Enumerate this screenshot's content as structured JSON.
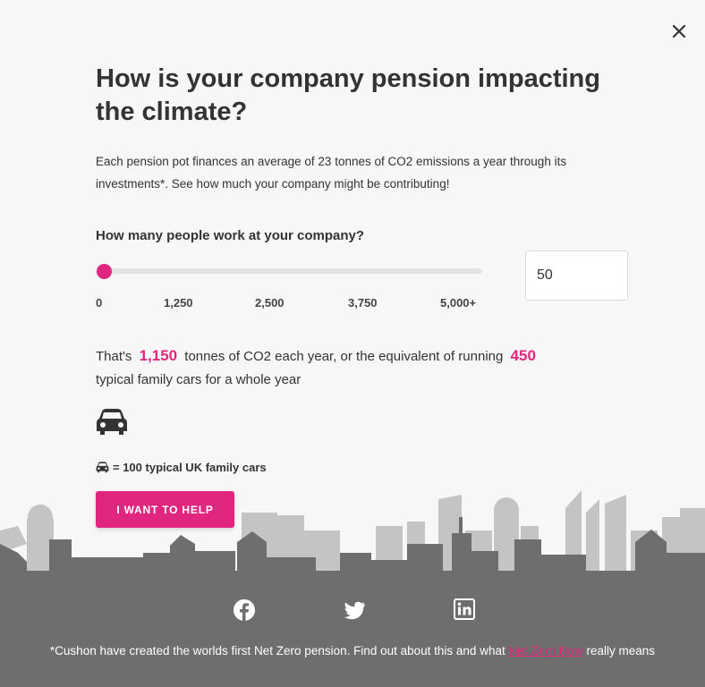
{
  "modal": {
    "close_icon": "close-icon",
    "title": "How is your company pension impacting the climate?",
    "intro": "Each pension pot finances an average of 23 tonnes of CO2 emissions a year through its investments*. See how much your company might be contributing!"
  },
  "calculator": {
    "question": "How many people work at your company?",
    "slider": {
      "ticks": [
        "0",
        "1,250",
        "2,500",
        "3,750",
        "5,000+"
      ],
      "min": 0,
      "max": 5000,
      "value": 50
    },
    "input_value": "50",
    "result": {
      "prefix": "That's",
      "tonnes": "1,150",
      "middle": "tonnes of CO2 each year, or the equivalent of running",
      "cars": "450",
      "suffix": "typical family cars for a whole year"
    },
    "car_icon": "car-icon",
    "legend_text": "= 100 typical UK family cars",
    "cta_label": "I WANT TO HELP"
  },
  "footer": {
    "social_icons": [
      "facebook-icon",
      "twitter-icon",
      "linkedin-icon"
    ],
    "note_before": "*Cushon have created the worlds first Net Zero pension. Find out about this and what",
    "note_link": "Net Zero Now",
    "note_after": "really means"
  },
  "colors": {
    "accent": "#e0267f",
    "background": "#f7f7f7",
    "footer": "#6e6e6e",
    "skyline_light": "#c4c4c4",
    "skyline_dark": "#6e6e6e"
  }
}
